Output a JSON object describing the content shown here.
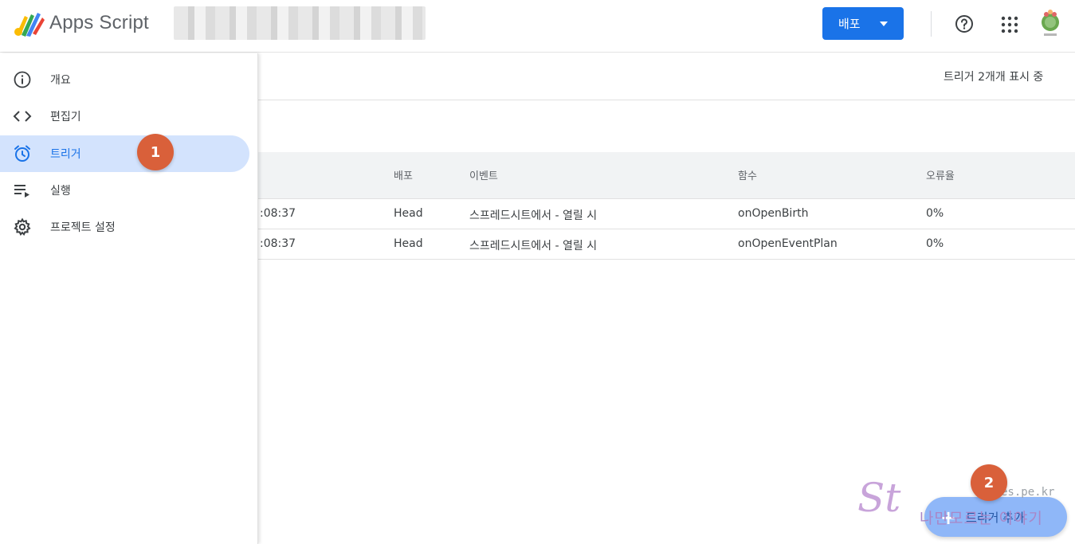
{
  "header": {
    "app_title": "Apps Script",
    "deploy_label": "배포",
    "icons": {
      "logo": "apps-script-logo",
      "help": "help-circle-icon",
      "apps": "apps-grid-icon",
      "avatar": "user-avatar"
    }
  },
  "sidebar": {
    "items": [
      {
        "label": "개요",
        "icon": "info-icon",
        "active": false
      },
      {
        "label": "편집기",
        "icon": "code-icon",
        "active": false
      },
      {
        "label": "트리거",
        "icon": "alarm-clock-icon",
        "active": true
      },
      {
        "label": "실행",
        "icon": "executions-icon",
        "active": false
      },
      {
        "label": "프로젝트 설정",
        "icon": "gear-icon",
        "active": false
      }
    ]
  },
  "main": {
    "count_text": "트리거 2개개 표시 중",
    "table": {
      "columns": [
        "배포",
        "이벤트",
        "함수",
        "오류율"
      ],
      "rows": [
        {
          "time": ":08:37",
          "deploy": "Head",
          "event": "스프레드시트에서 - 열릴 시",
          "function": "onOpenBirth",
          "error_rate": "0%"
        },
        {
          "time": ":08:37",
          "deploy": "Head",
          "event": "스프레드시트에서 - 열릴 시",
          "function": "onOpenEventPlan",
          "error_rate": "0%"
        }
      ]
    },
    "fab_label": "트리거 추가"
  },
  "annotations": {
    "badge_1": "1",
    "badge_2": "2"
  },
  "watermark": {
    "logo": "St",
    "domain": "es.pe.kr",
    "slogan": "나만모르는 이야기"
  },
  "colors": {
    "accent": "#1a73e8",
    "active_bg": "#d3e3fd",
    "badge": "#d9603a",
    "fab": "#8ab4f8"
  }
}
